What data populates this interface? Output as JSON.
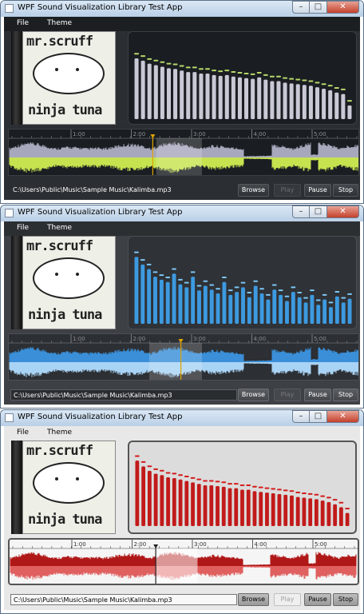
{
  "windows": [
    {
      "theme": "dark",
      "title": "WPF Sound Visualization Library Test App",
      "menu": [
        "File",
        "Theme"
      ],
      "album_lines": [
        "mr.scruff",
        "ninja tuna"
      ],
      "file_path": "C:\\Users\\Public\\Music\\Sample Music\\Kalimba.mp3",
      "buttons": {
        "browse": "Browse",
        "play": "Play",
        "pause": "Pause",
        "stop": "Stop"
      },
      "play_enabled": false,
      "timeline_ticks": [
        "1:00",
        "2:00",
        "3:00",
        "4:00",
        "5:00"
      ],
      "playhead_color": "#e0a400",
      "spectrum_bar_color": "#c9c9d6",
      "spectrum_peak_color": "#b7d86a",
      "wave_left_color": "#a8a8bd",
      "wave_right_color": "#c6e34f",
      "spectrum_levels": [
        0.8,
        0.77,
        0.73,
        0.71,
        0.69,
        0.67,
        0.66,
        0.64,
        0.62,
        0.62,
        0.6,
        0.6,
        0.58,
        0.57,
        0.58,
        0.56,
        0.55,
        0.54,
        0.53,
        0.55,
        0.52,
        0.5,
        0.5,
        0.48,
        0.47,
        0.46,
        0.45,
        0.44,
        0.42,
        0.4,
        0.38,
        0.35,
        0.33,
        0.18
      ],
      "playback_position": 0.41,
      "selection_range": [
        0.42,
        0.55
      ]
    },
    {
      "theme": "blue",
      "title": "WPF Sound Visualization Library Test App",
      "menu": [
        "File",
        "Theme"
      ],
      "album_lines": [
        "mr.scruff",
        "ninja tuna"
      ],
      "file_path": "C:\\Users\\Public\\Music\\Sample Music\\Kalimba.mp3",
      "buttons": {
        "browse": "Browse",
        "play": "Play",
        "pause": "Pause",
        "stop": "Stop"
      },
      "play_enabled": false,
      "timeline_ticks": [
        "1:00",
        "2:00",
        "3:00",
        "4:00",
        "5:00"
      ],
      "playhead_color": "#e0a400",
      "spectrum_bar_color": "#3d9ae0",
      "spectrum_peak_color": "#7cc6f5",
      "wave_left_color": "#3a8fd8",
      "wave_right_color": "#a9d3f5",
      "spectrum_levels": [
        0.88,
        0.78,
        0.72,
        0.62,
        0.58,
        0.55,
        0.66,
        0.52,
        0.48,
        0.62,
        0.44,
        0.5,
        0.45,
        0.4,
        0.55,
        0.38,
        0.42,
        0.48,
        0.35,
        0.5,
        0.4,
        0.32,
        0.45,
        0.38,
        0.3,
        0.42,
        0.35,
        0.28,
        0.38,
        0.25,
        0.32,
        0.22,
        0.36,
        0.28,
        0.33
      ],
      "playback_position": 0.49,
      "selection_range": [
        0.4,
        0.55
      ]
    },
    {
      "theme": "light",
      "title": "WPF Sound Visualization Library Test App",
      "menu": [
        "File",
        "Theme"
      ],
      "album_lines": [
        "mr.scruff",
        "ninja tuna"
      ],
      "file_path": "C:\\Users\\Public\\Music\\Sample Music\\Kalimba.mp3",
      "buttons": {
        "browse": "Browse",
        "play": "Play",
        "pause": "Pause",
        "stop": "Stop"
      },
      "play_enabled": false,
      "timeline_ticks": [
        "1:00",
        "2:00",
        "3:00",
        "4:00",
        "5:00"
      ],
      "playhead_color": "#222222",
      "spectrum_bar_color": "#c21a1a",
      "spectrum_peak_color": "#d41b1b",
      "wave_left_color": "#b01818",
      "wave_right_color": "#e06060",
      "spectrum_levels": [
        0.9,
        0.82,
        0.76,
        0.72,
        0.7,
        0.67,
        0.66,
        0.64,
        0.62,
        0.6,
        0.58,
        0.56,
        0.56,
        0.55,
        0.54,
        0.52,
        0.52,
        0.5,
        0.5,
        0.48,
        0.47,
        0.46,
        0.45,
        0.44,
        0.43,
        0.42,
        0.4,
        0.39,
        0.38,
        0.37,
        0.35,
        0.33,
        0.3,
        0.26,
        0.18
      ],
      "playback_position": 0.42,
      "selection_range": [
        0.42,
        0.54
      ]
    }
  ]
}
